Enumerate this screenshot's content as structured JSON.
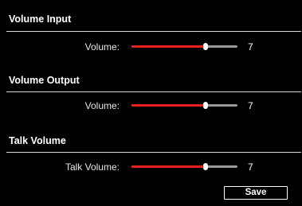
{
  "sections": [
    {
      "title": "Volume Input",
      "label": "Volume:",
      "value": "7",
      "level_fraction": 0.7,
      "colors": {
        "fill": "#e8201c",
        "track": "#9a9a9a",
        "thumb": "#ffffff"
      }
    },
    {
      "title": "Volume Output",
      "label": "Volume:",
      "value": "7",
      "level_fraction": 0.7,
      "colors": {
        "fill": "#e8201c",
        "track": "#9a9a9a",
        "thumb": "#ffffff"
      }
    },
    {
      "title": "Talk Volume",
      "label": "Talk Volume:",
      "value": "7",
      "level_fraction": 0.7,
      "colors": {
        "fill": "#e8201c",
        "track": "#9a9a9a",
        "thumb": "#ffffff"
      }
    }
  ],
  "save_label": "Save"
}
